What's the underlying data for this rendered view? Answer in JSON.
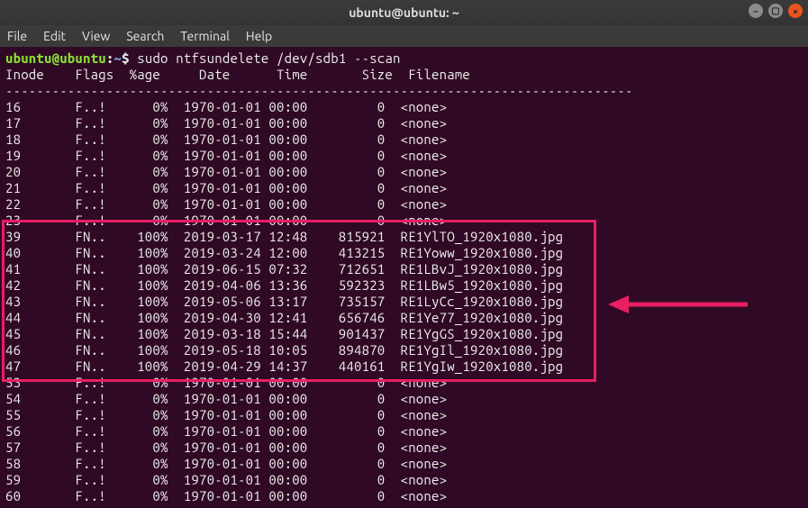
{
  "window": {
    "title": "ubuntu@ubuntu: ~"
  },
  "menu": {
    "items": [
      "File",
      "Edit",
      "View",
      "Search",
      "Terminal",
      "Help"
    ]
  },
  "prompt": {
    "user_host": "ubuntu@ubuntu",
    "sep": ":",
    "path": "~",
    "dollar": "$",
    "command": "sudo ntfsundelete /dev/sdb1 --scan"
  },
  "header": "Inode    Flags  %age     Date      Time       Size  Filename",
  "separator": "---------------------------------------------------------------------------------",
  "rows": [
    {
      "inode": "16",
      "flags": "F..!",
      "pct": "0%",
      "date": "1970-01-01",
      "time": "00:00",
      "size": "0",
      "name": "<none>"
    },
    {
      "inode": "17",
      "flags": "F..!",
      "pct": "0%",
      "date": "1970-01-01",
      "time": "00:00",
      "size": "0",
      "name": "<none>"
    },
    {
      "inode": "18",
      "flags": "F..!",
      "pct": "0%",
      "date": "1970-01-01",
      "time": "00:00",
      "size": "0",
      "name": "<none>"
    },
    {
      "inode": "19",
      "flags": "F..!",
      "pct": "0%",
      "date": "1970-01-01",
      "time": "00:00",
      "size": "0",
      "name": "<none>"
    },
    {
      "inode": "20",
      "flags": "F..!",
      "pct": "0%",
      "date": "1970-01-01",
      "time": "00:00",
      "size": "0",
      "name": "<none>"
    },
    {
      "inode": "21",
      "flags": "F..!",
      "pct": "0%",
      "date": "1970-01-01",
      "time": "00:00",
      "size": "0",
      "name": "<none>"
    },
    {
      "inode": "22",
      "flags": "F..!",
      "pct": "0%",
      "date": "1970-01-01",
      "time": "00:00",
      "size": "0",
      "name": "<none>"
    },
    {
      "inode": "23",
      "flags": "F..!",
      "pct": "0%",
      "date": "1970-01-01",
      "time": "00:00",
      "size": "0",
      "name": "<none>"
    },
    {
      "inode": "39",
      "flags": "FN..",
      "pct": "100%",
      "date": "2019-03-17",
      "time": "12:48",
      "size": "815921",
      "name": "RE1YlTO_1920x1080.jpg"
    },
    {
      "inode": "40",
      "flags": "FN..",
      "pct": "100%",
      "date": "2019-03-24",
      "time": "12:00",
      "size": "413215",
      "name": "RE1Yoww_1920x1080.jpg"
    },
    {
      "inode": "41",
      "flags": "FN..",
      "pct": "100%",
      "date": "2019-06-15",
      "time": "07:32",
      "size": "712651",
      "name": "RE1LBvJ_1920x1080.jpg"
    },
    {
      "inode": "42",
      "flags": "FN..",
      "pct": "100%",
      "date": "2019-04-06",
      "time": "13:36",
      "size": "592323",
      "name": "RE1LBw5_1920x1080.jpg"
    },
    {
      "inode": "43",
      "flags": "FN..",
      "pct": "100%",
      "date": "2019-05-06",
      "time": "13:17",
      "size": "735157",
      "name": "RE1LyCc_1920x1080.jpg"
    },
    {
      "inode": "44",
      "flags": "FN..",
      "pct": "100%",
      "date": "2019-04-30",
      "time": "12:41",
      "size": "656746",
      "name": "RE1Ye77_1920x1080.jpg"
    },
    {
      "inode": "45",
      "flags": "FN..",
      "pct": "100%",
      "date": "2019-03-18",
      "time": "15:44",
      "size": "901437",
      "name": "RE1YgGS_1920x1080.jpg"
    },
    {
      "inode": "46",
      "flags": "FN..",
      "pct": "100%",
      "date": "2019-05-18",
      "time": "10:05",
      "size": "894870",
      "name": "RE1YgIl_1920x1080.jpg"
    },
    {
      "inode": "47",
      "flags": "FN..",
      "pct": "100%",
      "date": "2019-04-29",
      "time": "14:37",
      "size": "440161",
      "name": "RE1YgIw_1920x1080.jpg"
    },
    {
      "inode": "53",
      "flags": "F..!",
      "pct": "0%",
      "date": "1970-01-01",
      "time": "00:00",
      "size": "0",
      "name": "<none>"
    },
    {
      "inode": "54",
      "flags": "F..!",
      "pct": "0%",
      "date": "1970-01-01",
      "time": "00:00",
      "size": "0",
      "name": "<none>"
    },
    {
      "inode": "55",
      "flags": "F..!",
      "pct": "0%",
      "date": "1970-01-01",
      "time": "00:00",
      "size": "0",
      "name": "<none>"
    },
    {
      "inode": "56",
      "flags": "F..!",
      "pct": "0%",
      "date": "1970-01-01",
      "time": "00:00",
      "size": "0",
      "name": "<none>"
    },
    {
      "inode": "57",
      "flags": "F..!",
      "pct": "0%",
      "date": "1970-01-01",
      "time": "00:00",
      "size": "0",
      "name": "<none>"
    },
    {
      "inode": "58",
      "flags": "F..!",
      "pct": "0%",
      "date": "1970-01-01",
      "time": "00:00",
      "size": "0",
      "name": "<none>"
    },
    {
      "inode": "59",
      "flags": "F..!",
      "pct": "0%",
      "date": "1970-01-01",
      "time": "00:00",
      "size": "0",
      "name": "<none>"
    },
    {
      "inode": "60",
      "flags": "F..!",
      "pct": "0%",
      "date": "1970-01-01",
      "time": "00:00",
      "size": "0",
      "name": "<none>"
    }
  ],
  "annotations": {
    "highlight_color": "#e91e63"
  }
}
